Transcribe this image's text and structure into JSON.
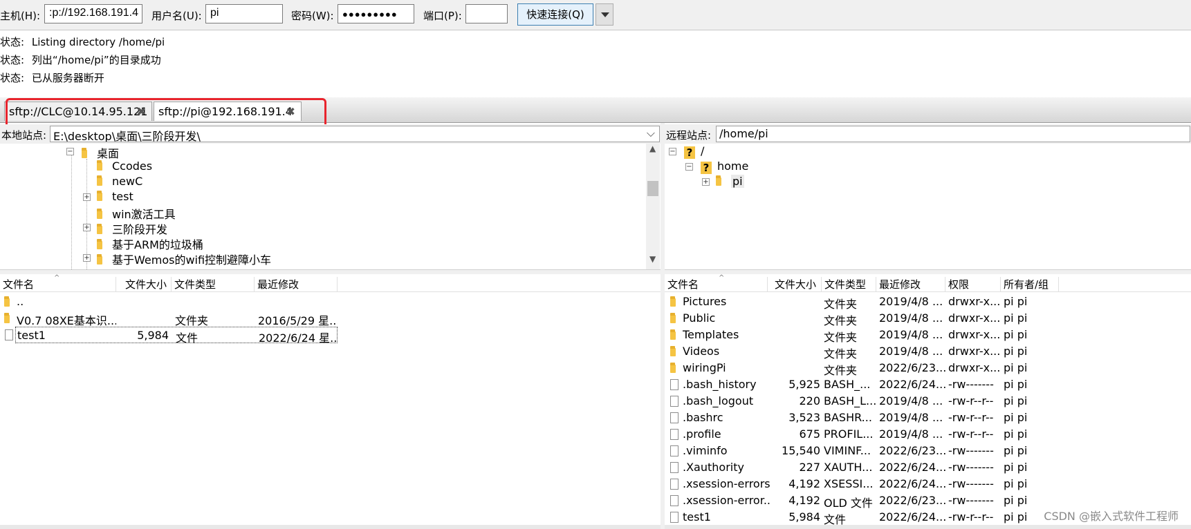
{
  "quickconnect": {
    "host_label": "主机(H):",
    "host_value": ":p://192.168.191.4",
    "user_label": "用户名(U):",
    "user_value": "pi",
    "pass_label": "密码(W):",
    "pass_value": "●●●●●●●●●",
    "port_label": "端口(P):",
    "port_value": "",
    "connect_button": "快速连接(Q)"
  },
  "log": [
    {
      "label": "状态:",
      "text": "Listing directory /home/pi"
    },
    {
      "label": "状态:",
      "text": "列出“/home/pi”的目录成功"
    },
    {
      "label": "状态:",
      "text": "已从服务器断开"
    }
  ],
  "tabs": [
    {
      "label": "sftp://CLC@10.14.95.121"
    },
    {
      "label": "sftp://pi@192.168.191.4"
    }
  ],
  "local": {
    "site_label": "本地站点:",
    "path": "E:\\desktop\\桌面\\三阶段开发\\",
    "tree": [
      {
        "label": "桌面",
        "expander": "⊟"
      },
      {
        "label": "Ccodes",
        "expander": ""
      },
      {
        "label": "newC",
        "expander": ""
      },
      {
        "label": "test",
        "expander": "⊞"
      },
      {
        "label": "win激活工具",
        "expander": ""
      },
      {
        "label": "三阶段开发",
        "expander": "⊞"
      },
      {
        "label": "基于ARM的垃圾桶",
        "expander": ""
      },
      {
        "label": "基于Wemos的wifi控制避障小车",
        "expander": "⊞"
      }
    ],
    "columns": [
      "文件名",
      "文件大小",
      "文件类型",
      "最近修改"
    ],
    "files": [
      {
        "name": "..",
        "size": "",
        "type": "",
        "modified": "",
        "icon": "folder"
      },
      {
        "name": "V0.7 08XE基本识...",
        "size": "",
        "type": "文件夹",
        "modified": "2016/5/29 星...",
        "icon": "folder"
      },
      {
        "name": "test1",
        "size": "5,984",
        "type": "文件",
        "modified": "2022/6/24 星...",
        "icon": "file"
      }
    ]
  },
  "remote": {
    "site_label": "远程站点:",
    "path": "/home/pi",
    "tree": [
      {
        "label": "/",
        "expander": "⊟",
        "icon": "question"
      },
      {
        "label": "home",
        "expander": "⊟",
        "icon": "question"
      },
      {
        "label": "pi",
        "expander": "⊞",
        "icon": "folder"
      }
    ],
    "columns": [
      "文件名",
      "文件大小",
      "文件类型",
      "最近修改",
      "权限",
      "所有者/组"
    ],
    "files": [
      {
        "name": "Pictures",
        "size": "",
        "type": "文件夹",
        "modified": "2019/4/8 ...",
        "perm": "drwxr-x...",
        "owner": "pi pi",
        "icon": "folder"
      },
      {
        "name": "Public",
        "size": "",
        "type": "文件夹",
        "modified": "2019/4/8 ...",
        "perm": "drwxr-x...",
        "owner": "pi pi",
        "icon": "folder"
      },
      {
        "name": "Templates",
        "size": "",
        "type": "文件夹",
        "modified": "2019/4/8 ...",
        "perm": "drwxr-x...",
        "owner": "pi pi",
        "icon": "folder"
      },
      {
        "name": "Videos",
        "size": "",
        "type": "文件夹",
        "modified": "2019/4/8 ...",
        "perm": "drwxr-x...",
        "owner": "pi pi",
        "icon": "folder"
      },
      {
        "name": "wiringPi",
        "size": "",
        "type": "文件夹",
        "modified": "2022/6/23...",
        "perm": "drwxr-x...",
        "owner": "pi pi",
        "icon": "folder"
      },
      {
        "name": ".bash_history",
        "size": "5,925",
        "type": "BASH_...",
        "modified": "2022/6/24...",
        "perm": "-rw-------",
        "owner": "pi pi",
        "icon": "file"
      },
      {
        "name": ".bash_logout",
        "size": "220",
        "type": "BASH_L...",
        "modified": "2019/4/8 ...",
        "perm": "-rw-r--r--",
        "owner": "pi pi",
        "icon": "file"
      },
      {
        "name": ".bashrc",
        "size": "3,523",
        "type": "BASHR...",
        "modified": "2019/4/8 ...",
        "perm": "-rw-r--r--",
        "owner": "pi pi",
        "icon": "file"
      },
      {
        "name": ".profile",
        "size": "675",
        "type": "PROFIL...",
        "modified": "2019/4/8 ...",
        "perm": "-rw-r--r--",
        "owner": "pi pi",
        "icon": "file"
      },
      {
        "name": ".viminfo",
        "size": "15,540",
        "type": "VIMINF...",
        "modified": "2022/6/23...",
        "perm": "-rw-------",
        "owner": "pi pi",
        "icon": "file"
      },
      {
        "name": ".Xauthority",
        "size": "227",
        "type": "XAUTH...",
        "modified": "2022/6/24...",
        "perm": "-rw-------",
        "owner": "pi pi",
        "icon": "file"
      },
      {
        "name": ".xsession-errors",
        "size": "4,192",
        "type": "XSESSI...",
        "modified": "2022/6/24...",
        "perm": "-rw-------",
        "owner": "pi pi",
        "icon": "file"
      },
      {
        "name": ".xsession-error...",
        "size": "4,192",
        "type": "OLD 文件",
        "modified": "2022/6/23...",
        "perm": "-rw-------",
        "owner": "pi pi",
        "icon": "file"
      },
      {
        "name": "test1",
        "size": "5,984",
        "type": "文件",
        "modified": "2022/6/24...",
        "perm": "-rw-r--r--",
        "owner": "pi pi",
        "icon": "file"
      }
    ]
  },
  "watermark": "CSDN @嵌入式软件工程师",
  "colors": {
    "highlight": "#e8242d",
    "folder": "#f5c443"
  }
}
